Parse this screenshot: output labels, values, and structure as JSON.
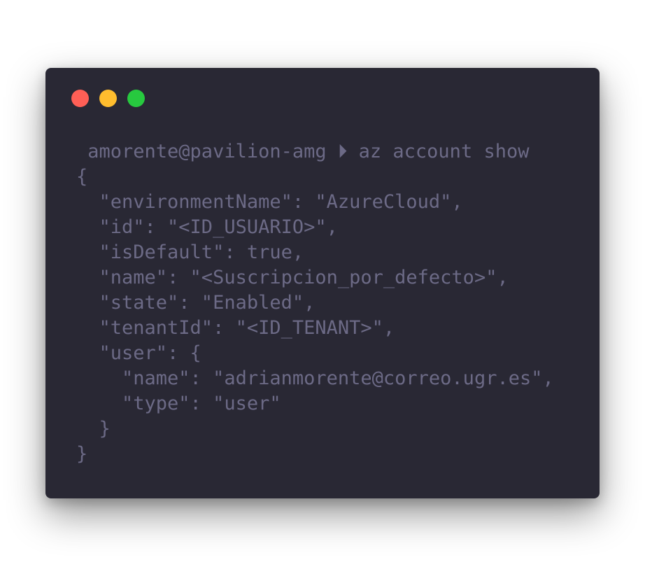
{
  "window": {
    "controls": [
      "close",
      "minimize",
      "maximize"
    ],
    "colors": {
      "background": "#292834",
      "text": "#6c6a86",
      "close": "#ff5f56",
      "minimize": "#ffbd2e",
      "maximize": "#27c93f"
    }
  },
  "prompt": {
    "user_host": " amorente@pavilion-amg",
    "arrow": " ⏵ ",
    "command": "az account show"
  },
  "output": [
    "{",
    "  \"environmentName\": \"AzureCloud\",",
    "  \"id\": \"<ID_USUARIO>\",",
    "  \"isDefault\": true,",
    "  \"name\": \"<Suscripcion_por_defecto>\",",
    "  \"state\": \"Enabled\",",
    "  \"tenantId\": \"<ID_TENANT>\",",
    "  \"user\": {",
    "    \"name\": \"adrianmorente@correo.ugr.es\",",
    "    \"type\": \"user\"",
    "  }",
    "}"
  ]
}
